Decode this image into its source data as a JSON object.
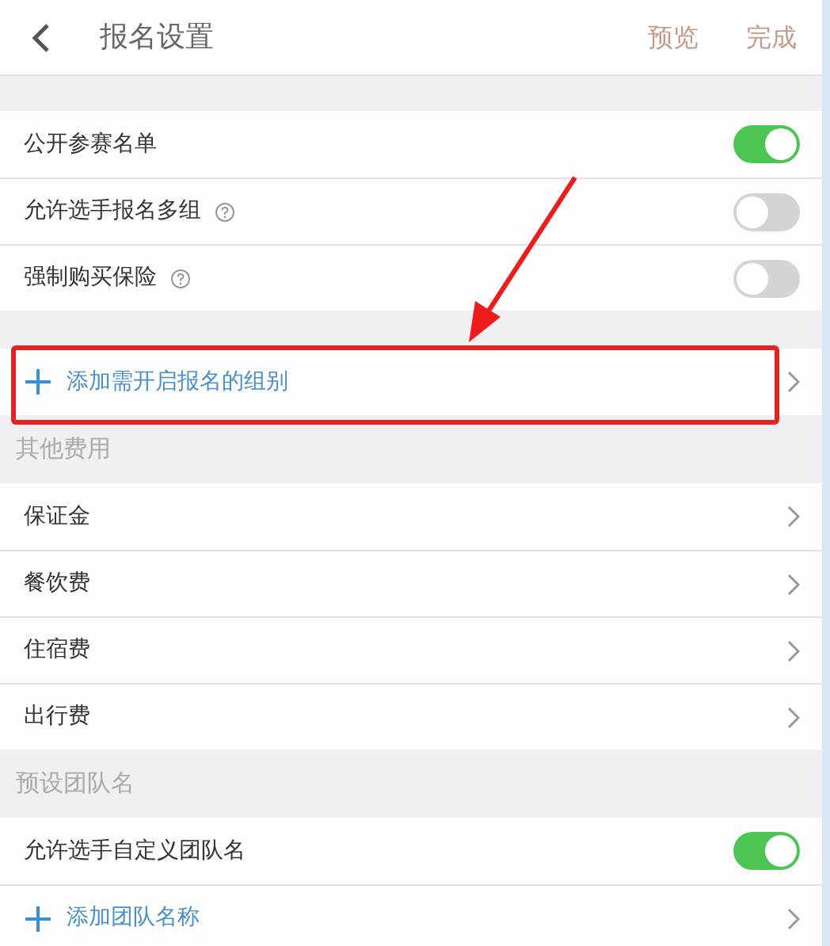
{
  "header": {
    "title": "报名设置",
    "actions": [
      "预览",
      "完成"
    ]
  },
  "sections": [
    {
      "rows": [
        {
          "kind": "toggle",
          "label": "公开参赛名单",
          "help": false,
          "on": true
        },
        {
          "kind": "toggle",
          "label": "允许选手报名多组",
          "help": true,
          "on": false
        },
        {
          "kind": "toggle",
          "label": "强制购买保险",
          "help": true,
          "on": false
        }
      ]
    },
    {
      "rows": [
        {
          "kind": "add",
          "label": "添加需开启报名的组别",
          "highlighted": true
        }
      ]
    },
    {
      "title": "其他费用",
      "rows": [
        {
          "kind": "link",
          "label": "保证金"
        },
        {
          "kind": "link",
          "label": "餐饮费"
        },
        {
          "kind": "link",
          "label": "住宿费"
        },
        {
          "kind": "link",
          "label": "出行费"
        }
      ]
    },
    {
      "title": "预设团队名",
      "rows": [
        {
          "kind": "toggle",
          "label": "允许选手自定义团队名",
          "help": false,
          "on": true
        },
        {
          "kind": "add",
          "label": "添加团队名称",
          "highlighted": false
        }
      ]
    }
  ]
}
